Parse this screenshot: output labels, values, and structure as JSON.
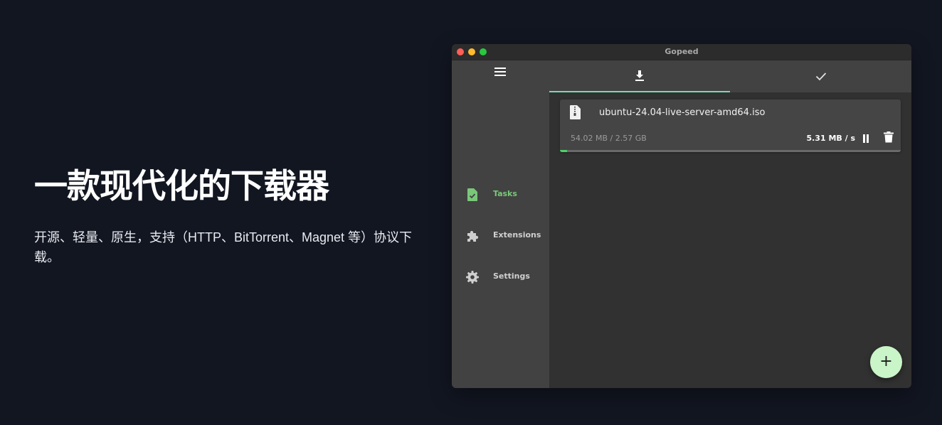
{
  "hero": {
    "title": "一款现代化的下载器",
    "description": "开源、轻量、原生，支持（HTTP、BitTorrent、Magnet 等）协议下载。"
  },
  "window": {
    "title": "Gopeed",
    "traffic_lights": [
      "#ff5f57",
      "#febc2e",
      "#28c840"
    ]
  },
  "sidebar": {
    "menu_icon": "hamburger-menu-icon",
    "items": [
      {
        "label": "Tasks",
        "icon": "file-check-icon",
        "active": true
      },
      {
        "label": "Extensions",
        "icon": "puzzle-icon",
        "active": false
      },
      {
        "label": "Settings",
        "icon": "gear-icon",
        "active": false
      }
    ]
  },
  "tabs": [
    {
      "icon": "download-icon",
      "active": true
    },
    {
      "icon": "check-icon",
      "active": false
    }
  ],
  "task": {
    "file_name": "ubuntu-24.04-live-server-amd64.iso",
    "size_text": "54.02 MB / 2.57 GB",
    "speed": "5.31 MB / s",
    "progress_percent": 2.05
  },
  "fab": {
    "label": "+"
  },
  "colors": {
    "accent_active": "#7ac77a",
    "tab_indicator": "#79d9b6",
    "progress": "#4fcf6a",
    "fab": "#c9f5c8"
  }
}
